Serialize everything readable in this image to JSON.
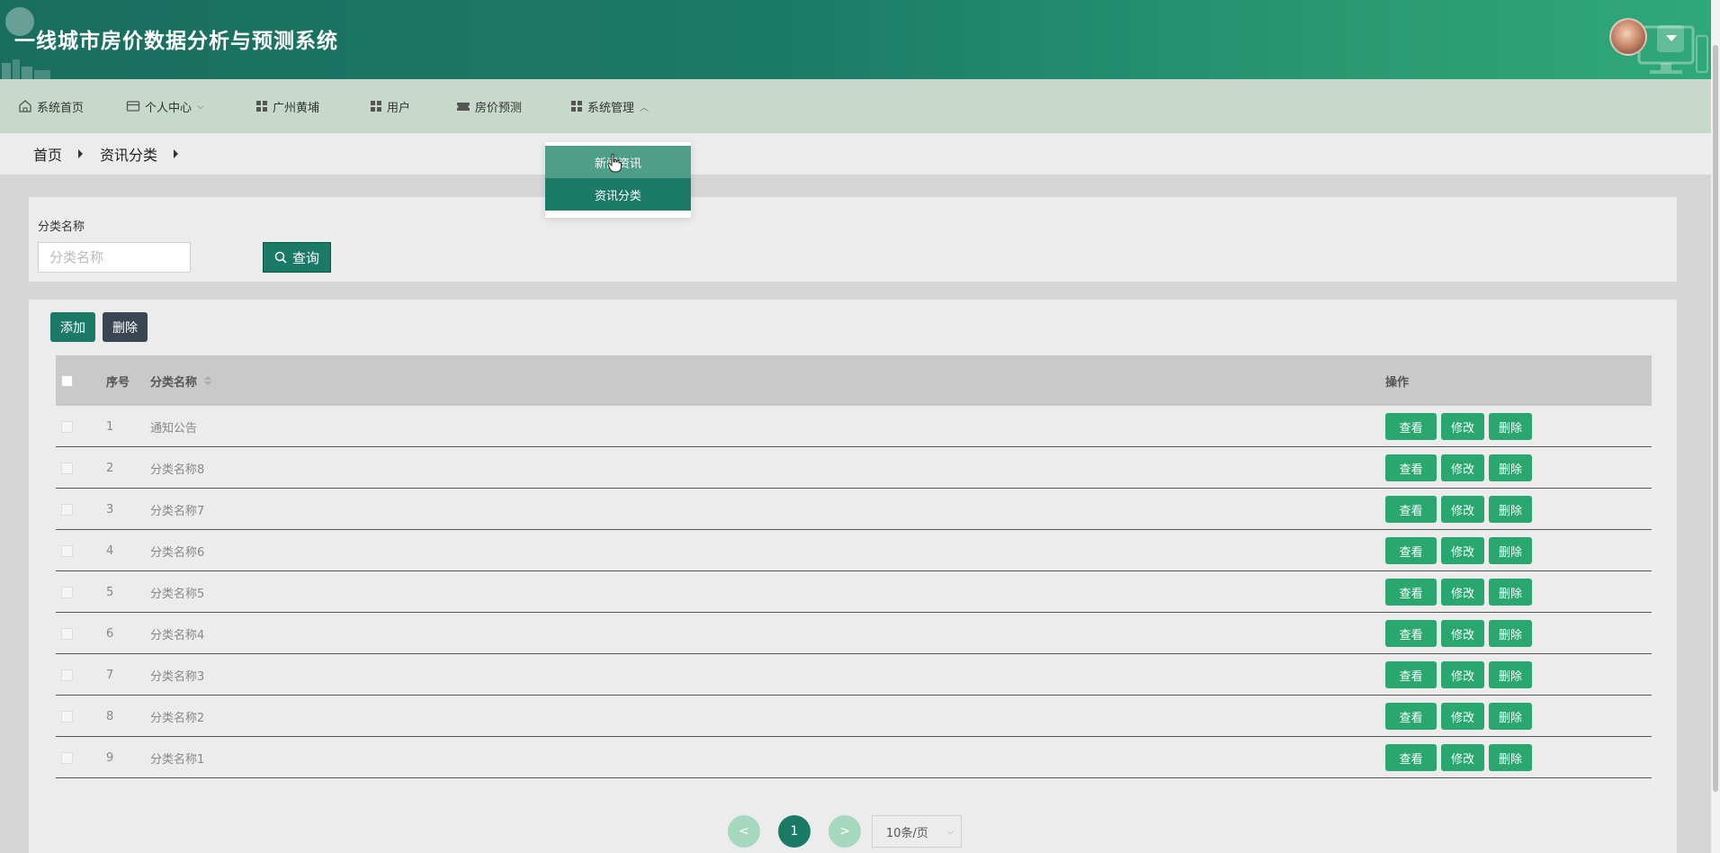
{
  "header": {
    "title": "一线城市房价数据分析与预测系统"
  },
  "nav": {
    "items": [
      {
        "label": "系统首页",
        "icon": "home-icon"
      },
      {
        "label": "个人中心",
        "icon": "card-icon",
        "has_dropdown": true
      },
      {
        "label": "广州黄埔",
        "icon": "grid-icon"
      },
      {
        "label": "用户",
        "icon": "grid-icon"
      },
      {
        "label": "房价预测",
        "icon": "ticket-icon"
      },
      {
        "label": "系统管理",
        "icon": "grid-icon",
        "has_dropdown": true,
        "expanded": true
      }
    ],
    "dropdown": {
      "items": [
        "新闻资讯",
        "资讯分类"
      ]
    }
  },
  "breadcrumb": {
    "items": [
      "首页",
      "资讯分类"
    ]
  },
  "search": {
    "label": "分类名称",
    "placeholder": "分类名称",
    "button_label": "查询"
  },
  "toolbar": {
    "add_label": "添加",
    "delete_label": "删除"
  },
  "table": {
    "headers": {
      "index": "序号",
      "name": "分类名称",
      "ops": "操作"
    },
    "op_labels": {
      "view": "查看",
      "edit": "修改",
      "delete": "删除"
    },
    "rows": [
      {
        "index": "1",
        "name": "通知公告"
      },
      {
        "index": "2",
        "name": "分类名称8"
      },
      {
        "index": "3",
        "name": "分类名称7"
      },
      {
        "index": "4",
        "name": "分类名称6"
      },
      {
        "index": "5",
        "name": "分类名称5"
      },
      {
        "index": "6",
        "name": "分类名称4"
      },
      {
        "index": "7",
        "name": "分类名称3"
      },
      {
        "index": "8",
        "name": "分类名称2"
      },
      {
        "index": "9",
        "name": "分类名称1"
      }
    ]
  },
  "pagination": {
    "prev": "<",
    "current": "1",
    "next": ">",
    "page_size": "10条/页"
  },
  "colors": {
    "primary": "#1b7a66",
    "action": "#2aa66f",
    "nav_bg": "#c6d9cb",
    "dark_button": "#3a4652"
  }
}
